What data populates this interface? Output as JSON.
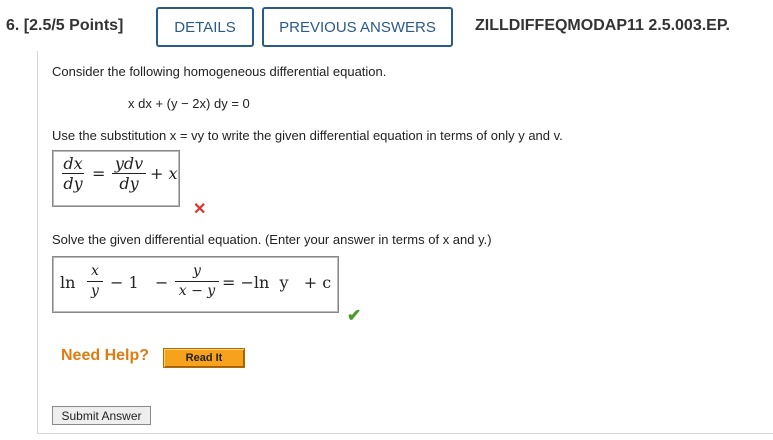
{
  "header": {
    "question_number": "6. [2.5/5 Points]",
    "details_label": "DETAILS",
    "previous_answers_label": "PREVIOUS ANSWERS",
    "question_code": "ZILLDIFFEQMODAP11 2.5.003.EP."
  },
  "problem": {
    "intro": "Consider the following homogeneous differential equation.",
    "equation": "x dx + (y − 2x) dy = 0",
    "instruction1": "Use the substitution x = vy to write the given differential equation in terms of only y and v.",
    "instruction2": "Solve the given differential equation. (Enter your answer in terms of x and y.)"
  },
  "answer1": {
    "lhs_num": "dx",
    "lhs_den": "dy",
    "equals": "=",
    "rhs_num": "ydv",
    "rhs_den": "dy",
    "plus_term": "+ x",
    "status": "incorrect",
    "status_icon": "x-mark-icon",
    "status_color": "#d9362b"
  },
  "answer2": {
    "ln": "ln",
    "frac1_num": "x",
    "frac1_den": "y",
    "minus_one": "− 1",
    "minus": "−",
    "frac2_num": "y",
    "frac2_den": "x − y",
    "rhs": "= −ln  y   + c",
    "status": "correct",
    "status_icon": "check-mark-icon",
    "status_color": "#4c9a2a"
  },
  "help": {
    "need_help_label": "Need Help?",
    "read_it_label": "Read It"
  },
  "submit_label": "Submit Answer",
  "colors": {
    "accent": "#2a5b84",
    "help_orange": "#e07b12",
    "button_orange": "#f7a21c"
  }
}
